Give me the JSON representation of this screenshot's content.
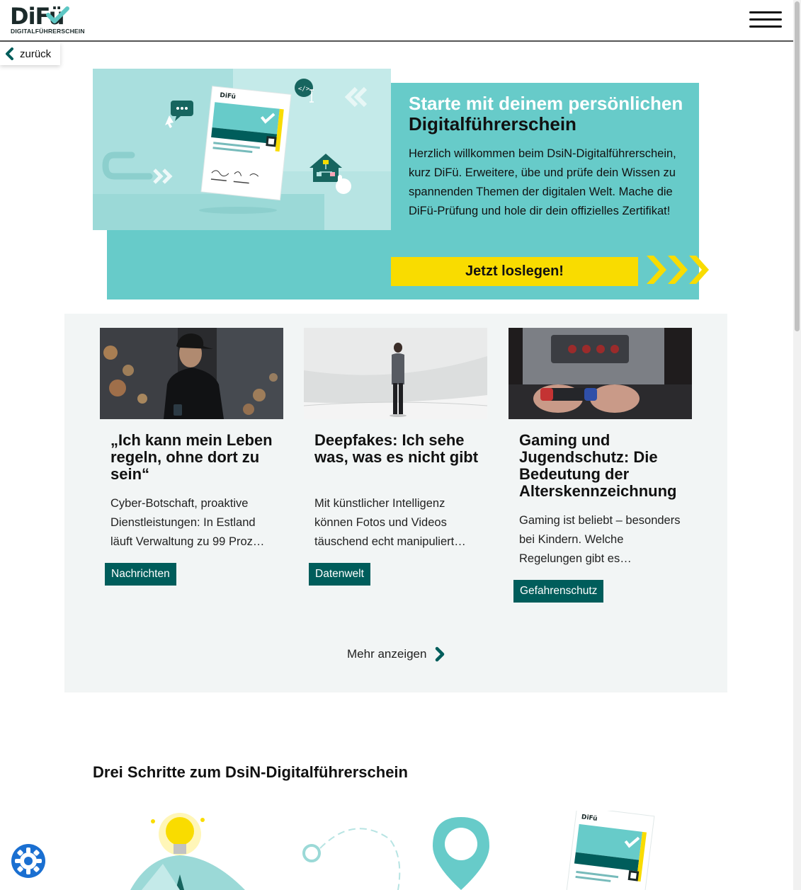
{
  "header": {
    "logo_text": "DiFü",
    "logo_subtitle": "DIGITALFÜHRERSCHEIN",
    "menu_icon": "hamburger-menu-icon"
  },
  "back": {
    "label": "zurück",
    "icon": "chevron-left-icon"
  },
  "hero": {
    "title_line1": "Starte mit deinem persönlichen",
    "title_line2": "Digitalführerschein",
    "text": "Herzlich willkommen beim DsiN-Digitalführerschein, kurz DiFü. Erweitere, übe und prüfe dein Wissen zu spannenden Themen der digitalen Welt. Mache die DiFü-Prüfung und hole dir dein offizielles Zertifikat!",
    "cta_label": "Jetzt loslegen!",
    "certificate_logo": "DiFü"
  },
  "articles": [
    {
      "title": "„Ich kann mein Leben regeln, ohne dort zu sein“",
      "excerpt": "Cyber-Botschaft, proaktive Dienstleistungen: In Estland läuft Verwaltung zu 99 Proz…",
      "tag": "Nachrichten"
    },
    {
      "title": "Deepfakes: Ich sehe was, was es nicht gibt",
      "excerpt": "Mit künstlicher Intelligenz können Fotos und Videos täuschend echt manipuliert…",
      "tag": "Datenwelt"
    },
    {
      "title": "Gaming und Jugendschutz: Die Bedeutung der Alterskennzeichnung",
      "excerpt": "Gaming ist beliebt – besonders bei Kindern. Welche Regelungen gibt es…",
      "tag": "Gefahrenschutz"
    }
  ],
  "more": {
    "label": "Mehr anzeigen",
    "icon": "chevron-right-icon"
  },
  "steps": {
    "title": "Drei Schritte zum DsiN-Digitalführerschein"
  },
  "colors": {
    "teal": "#67cbc9",
    "teal_light": "#b7e4e3",
    "dark_teal": "#005d5b",
    "yellow": "#f9dc00",
    "panel": "#f2f5f5"
  }
}
